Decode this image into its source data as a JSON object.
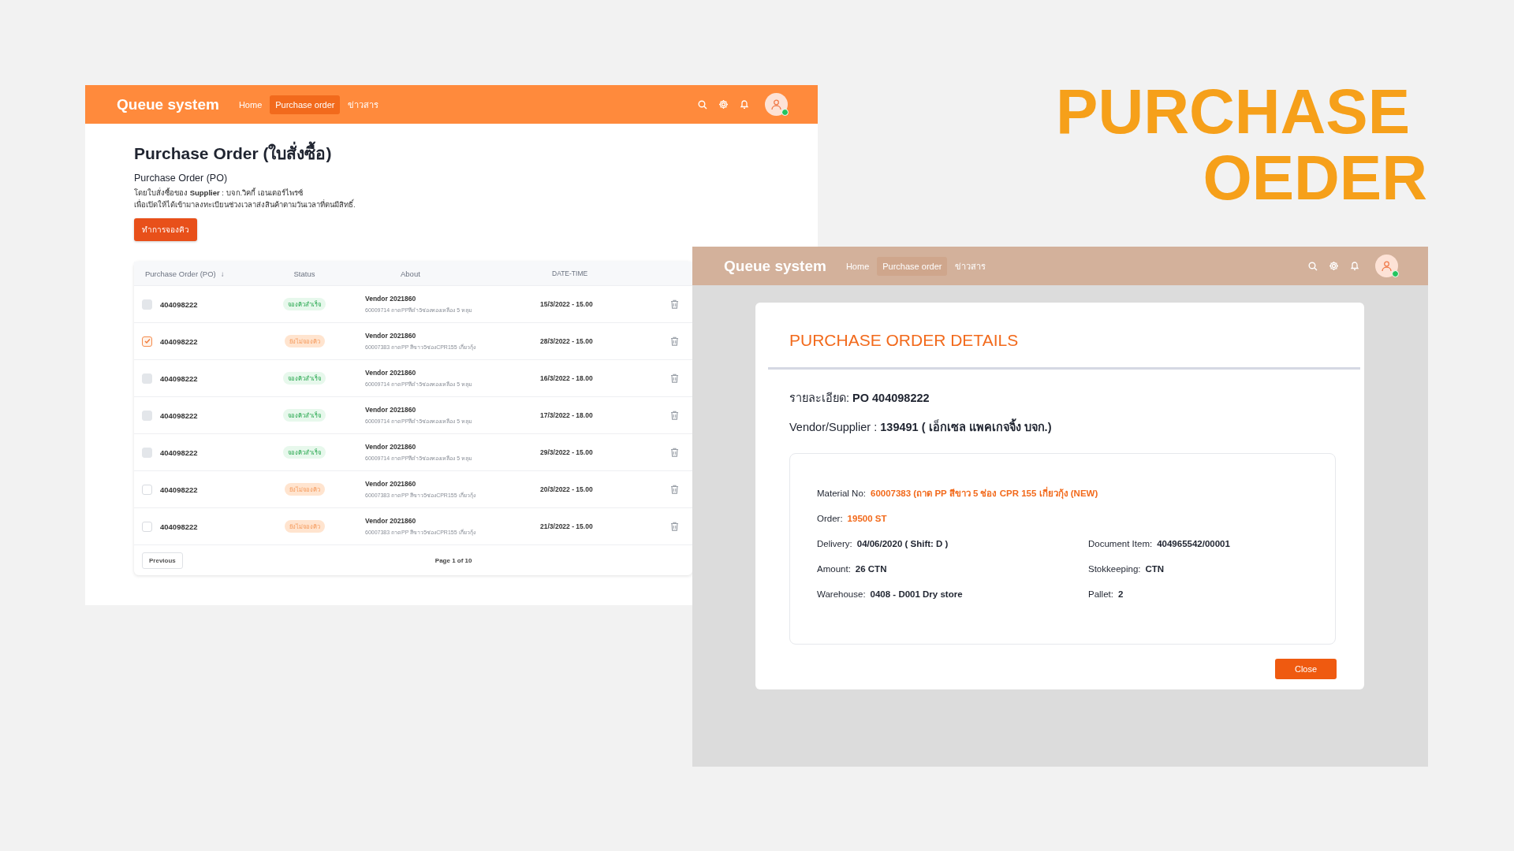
{
  "showcase_title": {
    "lines": [
      "PURCHASE",
      "OEDER"
    ]
  },
  "main_screen": {
    "header": {
      "logo": "Queue system",
      "nav": [
        {
          "label": "Home",
          "selected": false
        },
        {
          "label": "Purchase order",
          "selected": true
        },
        {
          "label": "ข่าวสาร",
          "selected": false
        }
      ],
      "online": true
    },
    "page": {
      "title": "Purchase Order (ใบสั่งซื้อ)",
      "subtitle": "Purchase Order (PO)",
      "description_lines": [
        "โดยใบสั่งซื้อของ **Supplier** : บจก.วิคกี้ เอนเตอร์ไพรซ์",
        "เพื่อเปิดให้ได้เข้ามาลงทะเบียนช่วงเวลาส่งสินค้าตามวันเวลาที่ตนมีสิทธิ์."
      ],
      "book_button": "ทำการจองคิว"
    },
    "table": {
      "columns": [
        {
          "label": "Purchase  Order (PO)",
          "sort_indicator": "↓"
        },
        {
          "label": "Status"
        },
        {
          "label": "About"
        },
        {
          "label": "DATE-TIME"
        }
      ],
      "rows": [
        {
          "checked": false,
          "disabled": true,
          "po": "404098222",
          "status": {
            "kind": "booked",
            "label": "จองคิวสำเร็จ"
          },
          "vendor": "Vendor 2021860",
          "item": "60009714 ถาดPPสีดำ5ช่องทองเหลือง 5 หลุม",
          "datetime": "15/3/2022 - 15.00"
        },
        {
          "checked": true,
          "disabled": false,
          "po": "404098222",
          "status": {
            "kind": "pending",
            "label": "ยังไม่จองคิว"
          },
          "vendor": "Vendor 2021860",
          "item": "60007383 ถาดPP สีขาว5ช่องCPR155 เกี่ยวกุ้ง",
          "datetime": "28/3/2022 - 15.00"
        },
        {
          "checked": false,
          "disabled": true,
          "po": "404098222",
          "status": {
            "kind": "booked",
            "label": "จองคิวสำเร็จ"
          },
          "vendor": "Vendor 2021860",
          "item": "60009714 ถาดPPสีดำ5ช่องทองเหลือง 5 หลุม",
          "datetime": "16/3/2022 - 18.00"
        },
        {
          "checked": false,
          "disabled": true,
          "po": "404098222",
          "status": {
            "kind": "booked",
            "label": "จองคิวสำเร็จ"
          },
          "vendor": "Vendor 2021860",
          "item": "60009714 ถาดPPสีดำ5ช่องทองเหลือง 5 หลุม",
          "datetime": "17/3/2022 - 18.00"
        },
        {
          "checked": false,
          "disabled": true,
          "po": "404098222",
          "status": {
            "kind": "booked",
            "label": "จองคิวสำเร็จ"
          },
          "vendor": "Vendor 2021860",
          "item": "60009714 ถาดPPสีดำ5ช่องทองเหลือง 5 หลุม",
          "datetime": "29/3/2022 - 15.00"
        },
        {
          "checked": false,
          "disabled": false,
          "po": "404098222",
          "status": {
            "kind": "pending",
            "label": "ยังไม่จองคิว"
          },
          "vendor": "Vendor 2021860",
          "item": "60007383 ถาดPP สีขาว5ช่องCPR155 เกี่ยวกุ้ง",
          "datetime": "20/3/2022 - 15.00"
        },
        {
          "checked": false,
          "disabled": false,
          "po": "404098222",
          "status": {
            "kind": "pending",
            "label": "ยังไม่จองคิว"
          },
          "vendor": "Vendor 2021860",
          "item": "60007383 ถาดPP สีขาว5ช่องCPR155 เกี่ยวกุ้ง",
          "datetime": "21/3/2022 - 15.00"
        }
      ],
      "previous_button": "Previous",
      "page_label": "Page 1 of 10"
    }
  },
  "modal_screen": {
    "header": {
      "logo": "Queue system",
      "nav": [
        {
          "label": "Home",
          "selected": false
        },
        {
          "label": "Purchase order",
          "selected": true
        },
        {
          "label": "ข่าวสาร",
          "selected": false
        }
      ],
      "online": true
    },
    "modal": {
      "title": "PURCHASE ORDER DETAILS",
      "detail_line": "รายละเอียด: **PO 404098222**",
      "vendor_line": "Vendor/Supplier : **139491 ( เอ็กเซล แพคเกจจิ้ง บจก.)**",
      "fields": [
        {
          "label": "Material No:",
          "value": "60007383  (ถาด PP สีขาว 5 ช่อง CPR 155 เกี่ยวกุ้ง (NEW)",
          "highlight": true,
          "kind": "wide"
        },
        {
          "label": "Order:",
          "value": "19500 ST",
          "highlight": true,
          "kind": "wide"
        },
        {
          "label": "Delivery:",
          "value": "04/06/2020 ( Shift: D )",
          "highlight": false,
          "kind": "half"
        },
        {
          "label": "Document Item:",
          "value": "404965542/00001",
          "highlight": false,
          "kind": "half"
        },
        {
          "label": "Amount:",
          "value": "26  CTN",
          "highlight": false,
          "kind": "half"
        },
        {
          "label": "Stokkeeping:",
          "value": "CTN",
          "highlight": false,
          "kind": "half"
        },
        {
          "label": "Warehouse:",
          "value": "0408 - D001 Dry store",
          "highlight": false,
          "kind": "half"
        },
        {
          "label": "Pallet:",
          "value": "2",
          "highlight": false,
          "kind": "half"
        }
      ],
      "close_button": "Close"
    }
  }
}
